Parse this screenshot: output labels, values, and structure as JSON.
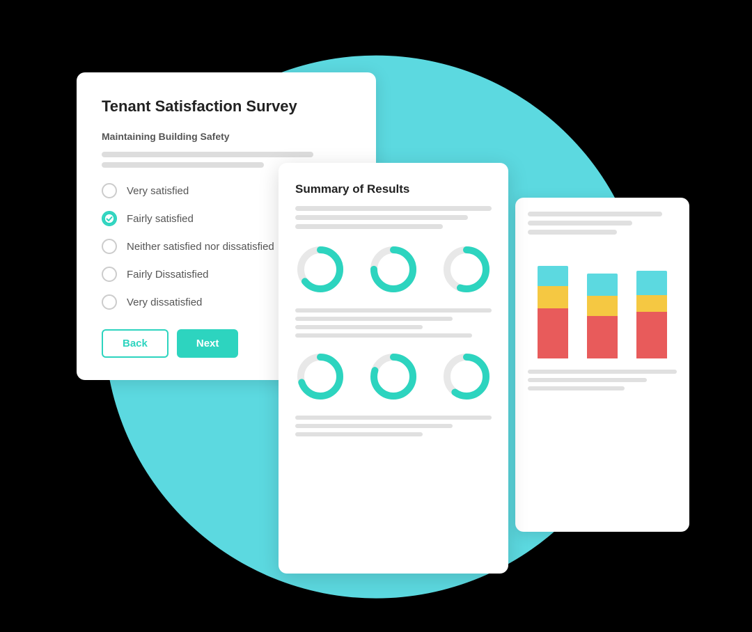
{
  "scene": {
    "teal_color": "#5cd9e0"
  },
  "survey_card": {
    "title": "Tenant Satisfaction Survey",
    "section_label": "Maintaining Building Safety",
    "options": [
      {
        "id": "very-satisfied",
        "label": "Very satisfied",
        "checked": false
      },
      {
        "id": "fairly-satisfied",
        "label": "Fairly satisfied",
        "checked": true
      },
      {
        "id": "neither",
        "label": "Neither satisfied nor dissatisfied",
        "checked": false
      },
      {
        "id": "fairly-dissatisfied",
        "label": "Fairly Dissatisfied",
        "checked": false
      },
      {
        "id": "very-dissatisfied",
        "label": "Very dissatisfied",
        "checked": false
      }
    ],
    "back_label": "Back",
    "next_label": "Next"
  },
  "results_card": {
    "title": "Summary of Results",
    "donuts": [
      {
        "percent": 65,
        "color": "#2dd4bf"
      },
      {
        "percent": 75,
        "color": "#2dd4bf"
      },
      {
        "percent": 55,
        "color": "#2dd4bf"
      }
    ],
    "donuts2": [
      {
        "percent": 70,
        "color": "#2dd4bf"
      },
      {
        "percent": 80,
        "color": "#2dd4bf"
      },
      {
        "percent": 60,
        "color": "#2dd4bf"
      }
    ]
  },
  "chart_card": {
    "bars": [
      {
        "segments": [
          {
            "color": "#5cd9e0",
            "height_pct": 18
          },
          {
            "color": "#f5c842",
            "height_pct": 20
          },
          {
            "color": "#e85b5b",
            "height_pct": 45
          }
        ]
      },
      {
        "segments": [
          {
            "color": "#5cd9e0",
            "height_pct": 20
          },
          {
            "color": "#f5c842",
            "height_pct": 18
          },
          {
            "color": "#e85b5b",
            "height_pct": 38
          }
        ]
      },
      {
        "segments": [
          {
            "color": "#5cd9e0",
            "height_pct": 22
          },
          {
            "color": "#f5c842",
            "height_pct": 15
          },
          {
            "color": "#e85b5b",
            "height_pct": 42
          }
        ]
      }
    ]
  }
}
